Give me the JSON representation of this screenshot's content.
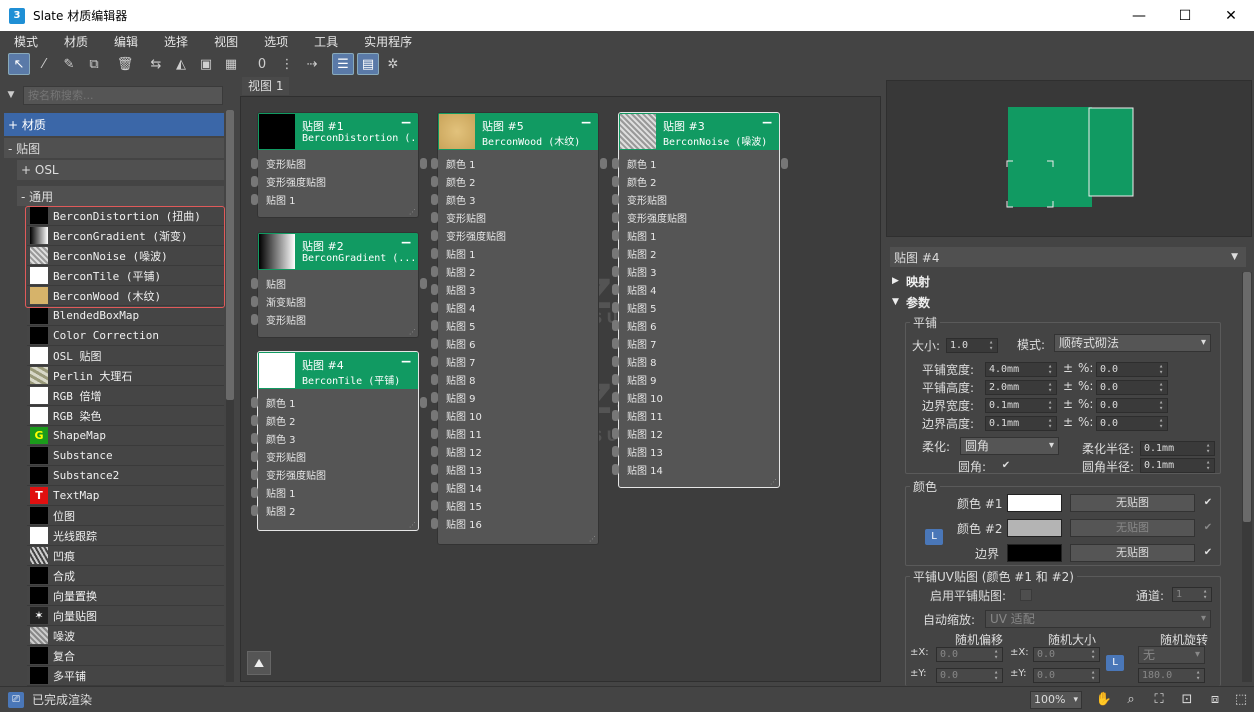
{
  "window": {
    "title": "Slate 材质编辑器",
    "app_icon": "3",
    "minimize": "—",
    "maximize": "☐",
    "close": "✕"
  },
  "menu": [
    "模式",
    "材质",
    "编辑",
    "选择",
    "视图",
    "选项",
    "工具",
    "实用程序"
  ],
  "toolbar": {
    "icons": [
      {
        "name": "select-arrow-icon",
        "glyph": "↖",
        "active": true
      },
      {
        "name": "pick-dropper-icon",
        "glyph": "⁄",
        "active": false
      },
      {
        "name": "assign-material-icon",
        "glyph": "✎",
        "active": false
      },
      {
        "name": "put-to-scene-icon",
        "glyph": "⧉",
        "active": false
      },
      {
        "name": "delete-icon",
        "glyph": "🗑",
        "active": false
      },
      {
        "name": "move-children-icon",
        "glyph": "⇆",
        "active": false
      },
      {
        "name": "hide-unused-slots-icon",
        "glyph": "◭",
        "active": false
      },
      {
        "name": "show-shaded-map-icon",
        "glyph": "▣",
        "active": false
      },
      {
        "name": "show-background-icon",
        "glyph": "▦",
        "active": false
      },
      {
        "name": "material-id-icon",
        "glyph": "0",
        "active": false
      },
      {
        "name": "layout-all-icon",
        "glyph": "⋮",
        "active": false
      },
      {
        "name": "layout-children-icon",
        "glyph": "⇢",
        "active": false
      },
      {
        "name": "material-map-browser-icon",
        "glyph": "☰",
        "active": true
      },
      {
        "name": "parameter-editor-icon",
        "glyph": "▤",
        "active": true
      },
      {
        "name": "select-by-material-icon",
        "glyph": "✲",
        "active": false
      }
    ]
  },
  "browser": {
    "search_placeholder": "按名称搜索...",
    "cat_materials": "+ 材质",
    "cat_maps": "- 贴图",
    "cat_osl": "+ OSL",
    "cat_general": "- 通用",
    "items": [
      {
        "label": "BerconDistortion (扭曲)",
        "swatch": "#000000",
        "glyph": ""
      },
      {
        "label": "BerconGradient (渐变)",
        "swatch": "linear-gradient(90deg,#000,#fff)",
        "glyph": ""
      },
      {
        "label": "BerconNoise (噪波)",
        "swatch": "repeating-linear-gradient(45deg,#999 0 2px,#ddd 2px 4px)",
        "glyph": ""
      },
      {
        "label": "BerconTile (平铺)",
        "swatch": "#ffffff",
        "glyph": ""
      },
      {
        "label": "BerconWood (木纹)",
        "swatch": "#d6b36a",
        "glyph": ""
      },
      {
        "label": "BlendedBoxMap",
        "swatch": "#000000",
        "glyph": ""
      },
      {
        "label": "Color Correction",
        "swatch": "#000000",
        "glyph": ""
      },
      {
        "label": "OSL 贴图",
        "swatch": "#ffffff",
        "glyph": ""
      },
      {
        "label": "Perlin 大理石",
        "swatch": "repeating-linear-gradient(30deg,#9a9a7a 0 3px,#d8d8c8 3px 6px)",
        "glyph": ""
      },
      {
        "label": "RGB 倍增",
        "swatch": "#ffffff",
        "glyph": ""
      },
      {
        "label": "RGB 染色",
        "swatch": "#ffffff",
        "glyph": ""
      },
      {
        "label": "ShapeMap",
        "swatch": "#1b9b1b",
        "glyph": "G"
      },
      {
        "label": "Substance",
        "swatch": "#000000",
        "glyph": ""
      },
      {
        "label": "Substance2",
        "swatch": "#000000",
        "glyph": ""
      },
      {
        "label": "TextMap",
        "swatch": "#e01010",
        "glyph": "T"
      },
      {
        "label": "位图",
        "swatch": "#000000",
        "glyph": ""
      },
      {
        "label": "光线跟踪",
        "swatch": "#ffffff",
        "glyph": ""
      },
      {
        "label": "凹痕",
        "swatch": "repeating-linear-gradient(60deg,#444 0 2px,#ccc 2px 4px)",
        "glyph": ""
      },
      {
        "label": "合成",
        "swatch": "#000000",
        "glyph": ""
      },
      {
        "label": "向量置换",
        "swatch": "#000000",
        "glyph": ""
      },
      {
        "label": "向量贴图",
        "swatch": "#222222",
        "glyph": "✶"
      },
      {
        "label": "噪波",
        "swatch": "repeating-linear-gradient(45deg,#888 0 2px,#ccc 2px 4px)",
        "glyph": ""
      },
      {
        "label": "复合",
        "swatch": "#000000",
        "glyph": ""
      },
      {
        "label": "多平铺",
        "swatch": "#000000",
        "glyph": ""
      }
    ]
  },
  "view": {
    "tab": "视图 1",
    "nodes": [
      {
        "title": "贴图 #1",
        "sub": "BerconDistortion (...",
        "thumb": "#000000",
        "ports": [
          "变形贴图",
          "变形强度贴图",
          "贴图 1"
        ],
        "selected": false
      },
      {
        "title": "贴图 #2",
        "sub": "BerconGradient (...",
        "thumb": "linear-gradient(90deg,#000,#fff)",
        "ports": [
          "贴图",
          "渐变贴图",
          "变形贴图"
        ],
        "selected": false
      },
      {
        "title": "贴图 #4",
        "sub": "BerconTile (平铺)",
        "thumb": "#ffffff",
        "ports": [
          "颜色 1",
          "颜色 2",
          "颜色 3",
          "变形贴图",
          "变形强度贴图",
          "贴图 1",
          "贴图 2"
        ],
        "selected": true
      },
      {
        "title": "贴图 #5",
        "sub": "BerconWood (木纹)",
        "thumb": "radial-gradient(circle,#e2c27c,#c9a45a)",
        "ports": [
          "颜色 1",
          "颜色 2",
          "颜色 3",
          "变形贴图",
          "变形强度贴图",
          "贴图 1",
          "贴图 2",
          "贴图 3",
          "贴图 4",
          "贴图 5",
          "贴图 6",
          "贴图 7",
          "贴图 8",
          "贴图 9",
          "贴图 10",
          "贴图 11",
          "贴图 12",
          "贴图 13",
          "贴图 14",
          "贴图 15",
          "贴图 16"
        ],
        "selected": false
      },
      {
        "title": "贴图 #3",
        "sub": "BerconNoise (噪波)",
        "thumb": "repeating-linear-gradient(45deg,#999 0 2px,#ddd 2px 4px)",
        "ports": [
          "颜色 1",
          "颜色 2",
          "变形贴图",
          "变形强度贴图",
          "贴图 1",
          "贴图 2",
          "贴图 3",
          "贴图 4",
          "贴图 5",
          "贴图 6",
          "贴图 7",
          "贴图 8",
          "贴图 9",
          "贴图 10",
          "贴图 11",
          "贴图 12",
          "贴图 13",
          "贴图 14"
        ],
        "selected": true
      }
    ],
    "minimize_glyph": "−",
    "resize_glyph": "⋰",
    "watermark_text": "IZ素材网",
    "watermark_sub": "IZSUCAI.COM",
    "nav_btn_glyph": "⛰"
  },
  "props": {
    "header": "贴图 #4",
    "rollout_mapping": "映射",
    "rollout_params": "参数",
    "tiling": {
      "title": "平铺",
      "size_label": "大小:",
      "size_value": "1.0",
      "mode_label": "模式:",
      "mode_value": "顺砖式砌法",
      "rows": [
        {
          "label": "平铺宽度:",
          "value": "4.0mm",
          "pm": "±",
          "pct": "%:",
          "pct_value": "0.0"
        },
        {
          "label": "平铺高度:",
          "value": "2.0mm",
          "pm": "±",
          "pct": "%:",
          "pct_value": "0.0"
        },
        {
          "label": "边界宽度:",
          "value": "0.1mm",
          "pm": "±",
          "pct": "%:",
          "pct_value": "0.0"
        },
        {
          "label": "边界高度:",
          "value": "0.1mm",
          "pm": "±",
          "pct": "%:",
          "pct_value": "0.0"
        }
      ],
      "soften_label": "柔化:",
      "soften_value": "圆角",
      "soften_radius_label": "柔化半径:",
      "soften_radius_value": "0.1mm",
      "round_label": "圆角:",
      "round_check": "✔",
      "round_radius_label": "圆角半径:",
      "round_radius_value": "0.1mm"
    },
    "colors": {
      "title": "颜色",
      "rows": [
        {
          "label": "颜色 #1",
          "color": "#ffffff",
          "map": "无贴图",
          "map_dis": false,
          "check": "✔"
        },
        {
          "label": "颜色 #2",
          "color": "#b4b4b4",
          "map": "无贴图",
          "map_dis": true,
          "check": "✔"
        },
        {
          "label": "边界",
          "color": "#000000",
          "map": "无贴图",
          "map_dis": false,
          "check": "✔"
        }
      ],
      "lock": "L"
    },
    "uv": {
      "title": "平铺UV贴图 (颜色 #1 和 #2)",
      "enable_label": "启用平铺贴图:",
      "channel_label": "通道:",
      "channel_value": "1",
      "autoscale_label": "自动缩放:",
      "autoscale_value": "UV 适配",
      "rand_offset": "随机偏移",
      "rand_size": "随机大小",
      "rand_rotate": "随机旋转",
      "zx_label": "±X:",
      "zx_value": "0.0",
      "px_label": "±X:",
      "px_value": "0.0",
      "rot_value": "无",
      "zy_label": "±Y:",
      "zy_value": "0.0",
      "py_label": "±Y:",
      "py_value": "0.0",
      "rot2_value": "180.0",
      "lock": "L"
    }
  },
  "status": {
    "icon": "⎚",
    "text": "已完成渲染",
    "zoom": "100%",
    "tools": [
      "✋",
      "⌕",
      "⛶",
      "⊡",
      "⧈",
      "⬚"
    ]
  },
  "colors": {
    "accent_green": "#119a62",
    "selection_blue": "#3b67a8",
    "highlight_red": "#e05a5a"
  }
}
